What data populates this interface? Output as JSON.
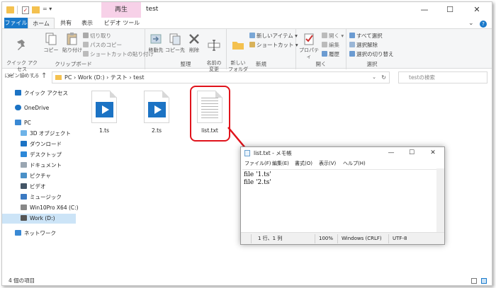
{
  "window": {
    "title": "test",
    "context_tab_group": "再生",
    "controls": {
      "minimize": "—",
      "maximize": "☐",
      "close": "✕"
    }
  },
  "ribbon": {
    "tabs": [
      "ファイル",
      "ホーム",
      "共有",
      "表示",
      "ビデオ ツール"
    ],
    "groups": {
      "clipboard": {
        "label": "クリップボード",
        "pin": "クイック アクセス\nにピン留めする",
        "copy": "コピー",
        "paste": "貼り付け",
        "cut": "切り取り",
        "copy_path": "パスのコピー",
        "paste_shortcut": "ショートカットの貼り付け"
      },
      "organize": {
        "label": "整理",
        "move_to": "移動先",
        "copy_to": "コピー先",
        "delete": "削除",
        "rename": "名前の\n変更"
      },
      "new": {
        "label": "新規",
        "new_folder": "新しい\nフォルダー",
        "new_item": "新しいアイテム ▾",
        "shortcut": "ショートカット ▾"
      },
      "open": {
        "label": "開く",
        "properties": "プロパティ",
        "open": "開く ▾",
        "edit": "編集",
        "history": "履歴"
      },
      "select": {
        "label": "選択",
        "select_all": "すべて選択",
        "select_none": "選択解除",
        "invert": "選択の切り替え"
      }
    }
  },
  "address": {
    "path": "PC  ›  Work (D:)  ›  テスト  ›  test",
    "search_placeholder": "testの検索"
  },
  "nav": {
    "items": [
      {
        "label": "クイック アクセス",
        "color": "#1c73c4"
      },
      {
        "label": "OneDrive",
        "color": "#1c73c4"
      },
      {
        "label": "PC",
        "color": "#3a89d4"
      },
      {
        "label": "3D オブジェクト",
        "color": "#6eb3e8"
      },
      {
        "label": "ダウンロード",
        "color": "#1c73c4"
      },
      {
        "label": "デスクトップ",
        "color": "#2d88d8"
      },
      {
        "label": "ドキュメント",
        "color": "#9aa6b2"
      },
      {
        "label": "ピクチャ",
        "color": "#4a90c8"
      },
      {
        "label": "ビデオ",
        "color": "#445566"
      },
      {
        "label": "ミュージック",
        "color": "#3b7ac2"
      },
      {
        "label": "Win10Pro X64 (C:)",
        "color": "#888888"
      },
      {
        "label": "Work (D:)",
        "color": "#555555"
      },
      {
        "label": "ネットワーク",
        "color": "#3a89d4"
      }
    ]
  },
  "files": [
    {
      "name": "1.ts",
      "type": "video"
    },
    {
      "name": "2.ts",
      "type": "video"
    },
    {
      "name": "list.txt",
      "type": "text"
    }
  ],
  "status": {
    "item_count": "4 個の項目"
  },
  "notepad": {
    "title": "list.txt - メモ帳",
    "menu": [
      "ファイル(F)",
      "編集(E)",
      "書式(O)",
      "表示(V)",
      "ヘルプ(H)"
    ],
    "lines": [
      "file '1.ts'",
      "file '2.ts'"
    ],
    "status": {
      "position": "1 行、1 列",
      "zoom": "100%",
      "line_ending": "Windows (CRLF)",
      "encoding": "UTF-8"
    }
  },
  "colors": {
    "accent": "#1979ca",
    "highlight": "#e0131b",
    "context_tab": "#f7d1e8"
  }
}
